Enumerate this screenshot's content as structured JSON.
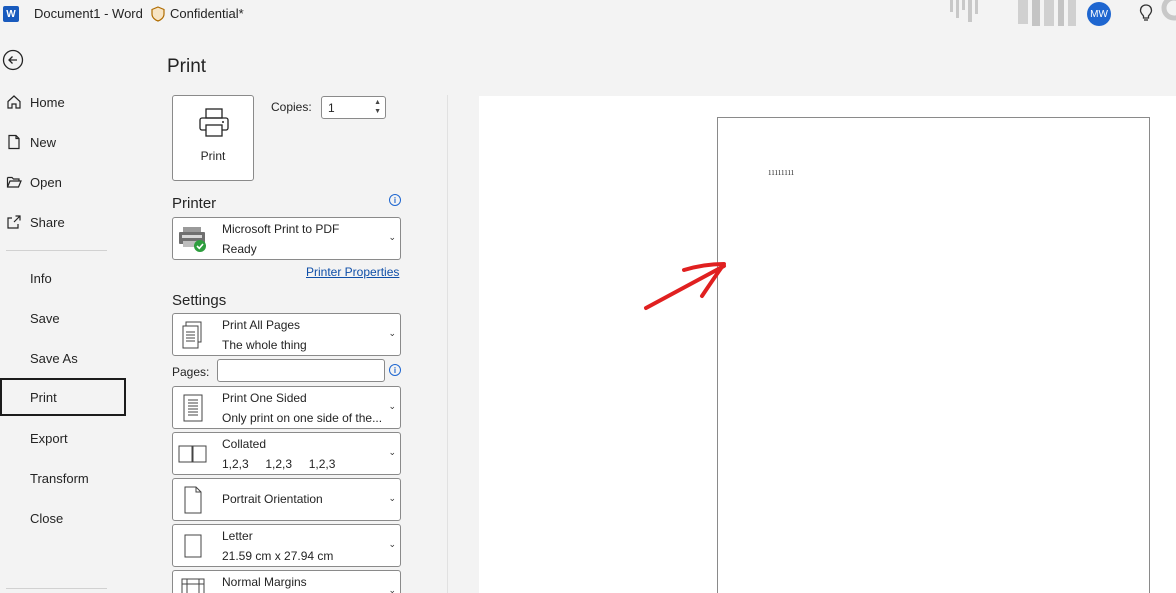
{
  "titlebar": {
    "app_icon_letter": "W",
    "doc_title": "Document1  -  Word",
    "sensitivity_label": "Confidential*",
    "avatar_initials": "MW",
    "icons": [
      "word-logo-icon",
      "shield-icon",
      "lightbulb-icon"
    ]
  },
  "nav": {
    "items": [
      {
        "label": "Home",
        "icon": "home-icon"
      },
      {
        "label": "New",
        "icon": "new-document-icon"
      },
      {
        "label": "Open",
        "icon": "folder-open-icon"
      },
      {
        "label": "Share",
        "icon": "share-icon"
      },
      {
        "label": "Info"
      },
      {
        "label": "Save"
      },
      {
        "label": "Save As"
      },
      {
        "label": "Print",
        "active": true
      },
      {
        "label": "Export"
      },
      {
        "label": "Transform"
      },
      {
        "label": "Close"
      }
    ]
  },
  "print": {
    "heading": "Print",
    "print_button_label": "Print",
    "copies_label": "Copies:",
    "copies_value": "1",
    "printer_heading": "Printer",
    "printer_name": "Microsoft Print to PDF",
    "printer_status": "Ready",
    "printer_properties_link": "Printer Properties",
    "settings_heading": "Settings",
    "settings": [
      {
        "line1": "Print All Pages",
        "line2": "The whole thing",
        "icon": "pages-icon"
      },
      {
        "line1": "Print One Sided",
        "line2": "Only print on one side of the...",
        "icon": "one-sided-icon"
      },
      {
        "line1": "Collated",
        "line2": "1,2,3     1,2,3     1,2,3",
        "icon": "collated-icon"
      },
      {
        "line1": "Portrait Orientation",
        "line2": "",
        "icon": "portrait-icon"
      },
      {
        "line1": "Letter",
        "line2": "21.59 cm x 27.94 cm",
        "icon": "paper-size-icon"
      },
      {
        "line1": "Normal Margins",
        "line2": "",
        "icon": "margins-icon"
      }
    ],
    "pages_label": "Pages:",
    "pages_value": ""
  },
  "preview": {
    "page_text": "11111111",
    "annotation": "red-arrow"
  },
  "colors": {
    "accent": "#185abd",
    "link": "#0f4fa8",
    "annotation_arrow": "#e02020",
    "avatar": "#1e66d0"
  }
}
